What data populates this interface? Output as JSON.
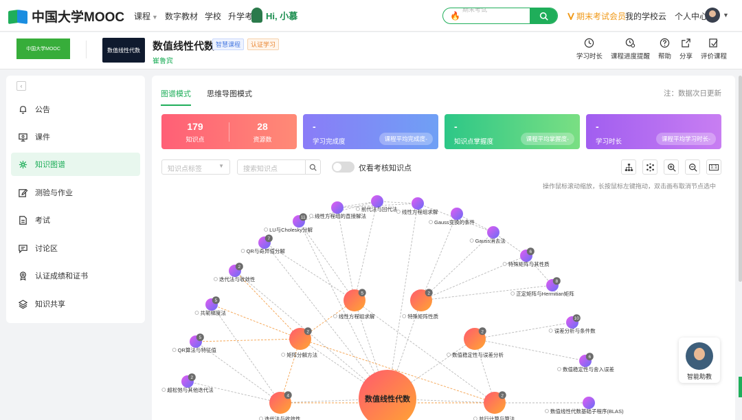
{
  "topnav": {
    "logo": "中国大学MOOC",
    "links": [
      "课程",
      "数字教材",
      "学校",
      "升学考研"
    ],
    "greeting": "Hi, 小慕",
    "search_placeholder": "期末考试",
    "vip": "期末考试会员",
    "right_links": [
      "我的学校云",
      "个人中心"
    ]
  },
  "course": {
    "school_logo_text": "中国大学MOOC",
    "thumb_text": "数值线性代数",
    "title": "数值线性代数",
    "tag_smart": "智慧课程",
    "tag_cert": "认证学习",
    "teacher": "崔鲁宾",
    "tools": [
      "学习时长",
      "课程进度提醒",
      "帮助",
      "分享",
      "评价课程"
    ]
  },
  "sidebar": {
    "items": [
      {
        "label": "公告",
        "icon": "bell-icon"
      },
      {
        "label": "课件",
        "icon": "courseware-icon"
      },
      {
        "label": "知识图谱",
        "icon": "graph-icon"
      },
      {
        "label": "测验与作业",
        "icon": "edit-icon"
      },
      {
        "label": "考试",
        "icon": "exam-icon"
      },
      {
        "label": "讨论区",
        "icon": "chat-icon"
      },
      {
        "label": "认证成绩和证书",
        "icon": "certificate-icon"
      },
      {
        "label": "知识共享",
        "icon": "layers-icon"
      }
    ],
    "active_index": 2
  },
  "main": {
    "tabs": [
      "图谱模式",
      "思维导图模式"
    ],
    "note": "注：数据次日更新",
    "cards": {
      "knowledge_points": {
        "value": "179",
        "label": "知识点"
      },
      "resources": {
        "value": "28",
        "label": "资源数"
      },
      "completion": {
        "value": "-",
        "label": "学习完成度",
        "pill": "课程平均完成度-"
      },
      "mastery": {
        "value": "-",
        "label": "知识点掌握度",
        "pill": "课程平均掌握度-"
      },
      "duration": {
        "value": "-",
        "label": "学习时长",
        "pill": "课程平均学习时长-"
      }
    },
    "filters": {
      "tag_placeholder": "知识点标签",
      "search_placeholder": "搜索知识点",
      "toggle_label": "仅看考核知识点"
    },
    "zoom_reset_label": "1:1",
    "hint": "操作鼠标滚动缩放，长按鼠标左键拖动，双击画布取消节点选中"
  },
  "graph": {
    "center": "数值线性代数",
    "nodes": [
      {
        "label": "前代法与回代法",
        "badge": ""
      },
      {
        "label": "线性方程组的直接解法",
        "badge": ""
      },
      {
        "label": "线性方程组求解",
        "badge": ""
      },
      {
        "label": "LU与Cholesky分解",
        "badge": "11"
      },
      {
        "label": "Gauss变换的条件",
        "badge": ""
      },
      {
        "label": "Gauss消去法",
        "badge": ""
      },
      {
        "label": "QR与奇异值分解",
        "badge": "7"
      },
      {
        "label": "特殊矩阵与其性质",
        "badge": "6"
      },
      {
        "label": "迭代法与收敛性",
        "badge": "2"
      },
      {
        "label": "正定矩阵与Hermitian矩阵",
        "badge": "8"
      },
      {
        "label": "线性方程组求解",
        "badge": "5"
      },
      {
        "label": "特殊矩阵性质",
        "badge": "2"
      },
      {
        "label": "共轭梯度法",
        "badge": "5"
      },
      {
        "label": "误差分析与条件数",
        "badge": "10"
      },
      {
        "label": "矩阵分解方法",
        "badge": "2"
      },
      {
        "label": "数值稳定性与误差分析",
        "badge": "2"
      },
      {
        "label": "QR算法与特征值",
        "badge": "5"
      },
      {
        "label": "数值稳定性与舍入误差",
        "badge": "6"
      },
      {
        "label": "超松弛与其他迭代法",
        "badge": "2"
      },
      {
        "label": "迭代法与收敛性",
        "badge": "4"
      },
      {
        "label": "并行计算与算法",
        "badge": "2"
      },
      {
        "label": "数值线性代数基础子程序(BLAS)",
        "badge": ""
      }
    ]
  },
  "assistant": {
    "label": "智能助教"
  }
}
